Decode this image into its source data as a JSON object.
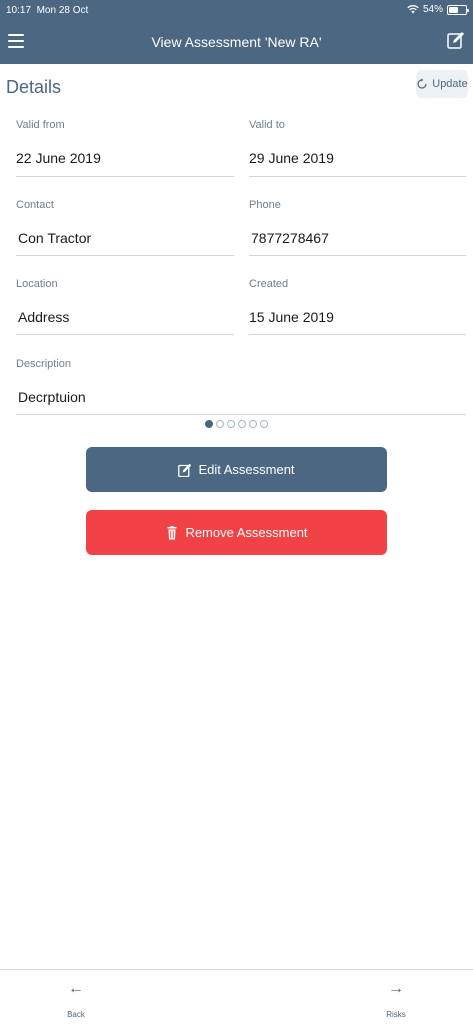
{
  "status_bar": {
    "time": "10:17",
    "date": "Mon 28 Oct",
    "battery": "54%"
  },
  "nav": {
    "title": "View Assessment 'New RA'"
  },
  "details": {
    "title": "Details",
    "update_label": "Update"
  },
  "fields": {
    "valid_from": {
      "label": "Valid from",
      "value": "22 June 2019"
    },
    "valid_to": {
      "label": "Valid to",
      "value": "29 June 2019"
    },
    "contact": {
      "label": "Contact",
      "value": "Con Tractor"
    },
    "phone": {
      "label": "Phone",
      "value": "7877278467"
    },
    "location": {
      "label": "Location",
      "value": "Address"
    },
    "created": {
      "label": "Created",
      "value": "15 June 2019"
    },
    "description": {
      "label": "Description",
      "value": "Decrptuion"
    }
  },
  "pager": {
    "total": 6,
    "active": 1
  },
  "actions": {
    "edit_label": "Edit Assessment",
    "remove_label": "Remove Assessment"
  },
  "bottom_nav": {
    "back_label": "Back",
    "risks_label": "Risks"
  },
  "colors": {
    "primary": "#4b6782",
    "danger": "#f14245"
  }
}
